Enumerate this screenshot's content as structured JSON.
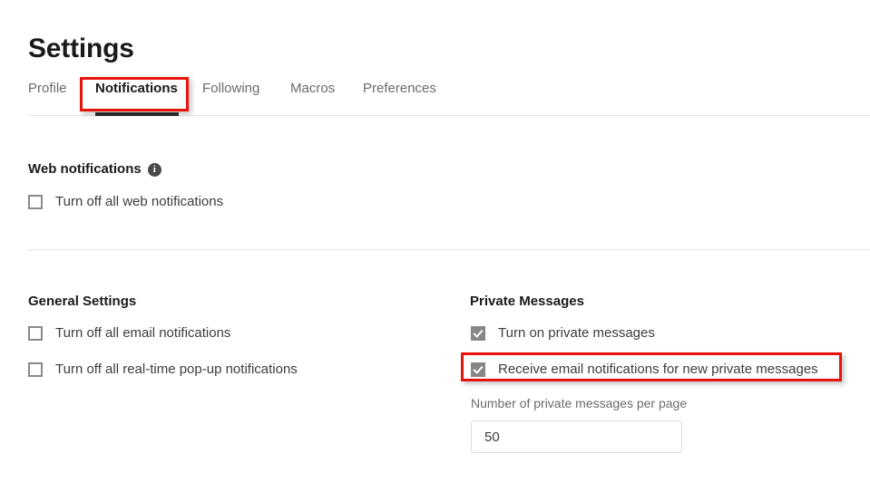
{
  "page": {
    "title": "Settings"
  },
  "tabs": [
    {
      "label": "Profile",
      "active": false
    },
    {
      "label": "Notifications",
      "active": true
    },
    {
      "label": "Following",
      "active": false
    },
    {
      "label": "Macros",
      "active": false
    },
    {
      "label": "Preferences",
      "active": false
    }
  ],
  "web_notifications": {
    "heading": "Web notifications",
    "info_icon": "info-icon",
    "info_glyph": "i",
    "options": [
      {
        "label": "Turn off all web notifications",
        "checked": false
      }
    ]
  },
  "general_settings": {
    "heading": "General Settings",
    "options": [
      {
        "label": "Turn off all email notifications",
        "checked": false
      },
      {
        "label": "Turn off all real-time pop-up notifications",
        "checked": false
      }
    ]
  },
  "private_messages": {
    "heading": "Private Messages",
    "options": [
      {
        "label": "Turn on private messages",
        "checked": true
      },
      {
        "label": "Receive email notifications for new private messages",
        "checked": true
      }
    ],
    "per_page": {
      "label": "Number of private messages per page",
      "value": "50",
      "placeholder": ""
    }
  },
  "annotations": {
    "accent_color": "#e8140c",
    "highlighted": [
      "Notifications",
      "Receive email notifications for new private messages"
    ]
  }
}
